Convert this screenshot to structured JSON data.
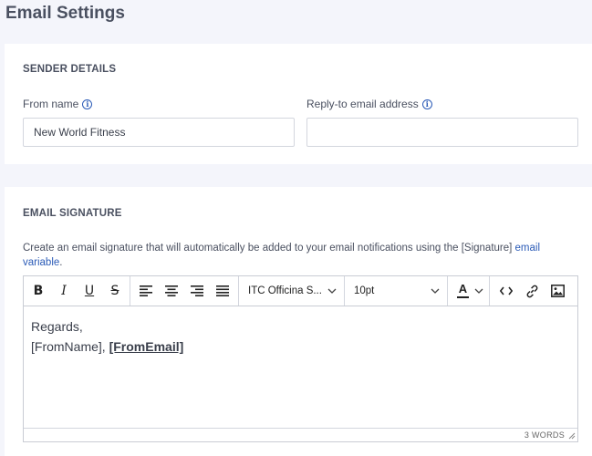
{
  "page": {
    "title": "Email Settings"
  },
  "sender": {
    "heading": "SENDER DETAILS",
    "from_name": {
      "label": "From name",
      "value": "New World Fitness"
    },
    "reply_to": {
      "label": "Reply-to email address",
      "value": ""
    }
  },
  "signature": {
    "heading": "EMAIL SIGNATURE",
    "description": "Create an email signature that will automatically be added to your email notifications using the [Signature] ",
    "description_link": "email variable",
    "description_end": ".",
    "editor": {
      "font_family": "ITC Officina S...",
      "font_size": "10pt",
      "text_color_label": "A",
      "text_color": "#222222",
      "line1": "Regards,",
      "line2_prefix": "[FromName], ",
      "line2_link": "[FromEmail]",
      "word_count": "3 WORDS"
    }
  },
  "icons": {
    "info": "info-icon",
    "bold": "bold-icon",
    "italic": "italic-icon",
    "underline": "underline-icon",
    "strikethrough": "strikethrough-icon",
    "align_left": "align-left-icon",
    "align_center": "align-center-icon",
    "align_right": "align-right-icon",
    "justify": "justify-icon",
    "code": "code-icon",
    "link": "link-icon",
    "image": "image-icon"
  },
  "colors": {
    "accent": "#2b5bb7",
    "background": "#f4f5fb"
  }
}
